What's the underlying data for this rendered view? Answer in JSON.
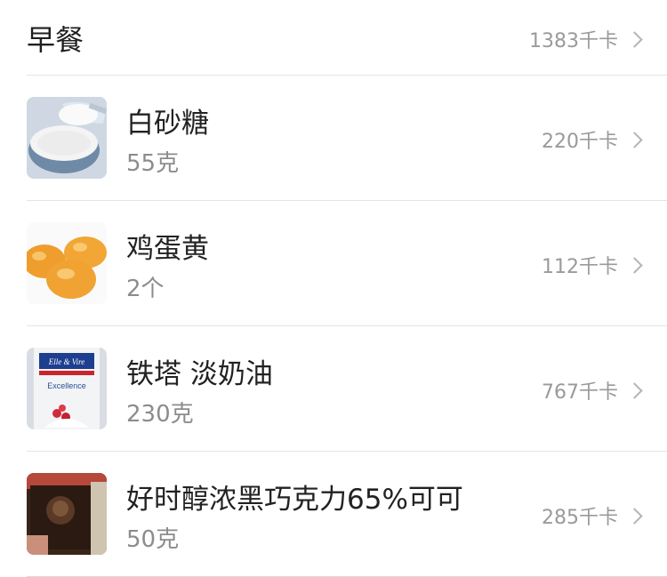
{
  "meal": {
    "title": "早餐",
    "total_kcal": "1383千卡"
  },
  "foods": [
    {
      "name": "白砂糖",
      "amount": "55克",
      "kcal": "220千卡",
      "icon": "sugar-image"
    },
    {
      "name": "鸡蛋黄",
      "amount": "2个",
      "kcal": "112千卡",
      "icon": "egg-yolk-image"
    },
    {
      "name": "铁塔 淡奶油",
      "amount": "230克",
      "kcal": "767千卡",
      "icon": "cream-carton-image",
      "package_text": "Elle & Vire",
      "package_line2": "Excellence"
    },
    {
      "name": "好时醇浓黑巧克力65%可可",
      "amount": "50克",
      "kcal": "285千卡",
      "icon": "chocolate-image"
    }
  ],
  "colors": {
    "secondary_text": "#9a9a9a",
    "divider": "#e4e4e4"
  }
}
